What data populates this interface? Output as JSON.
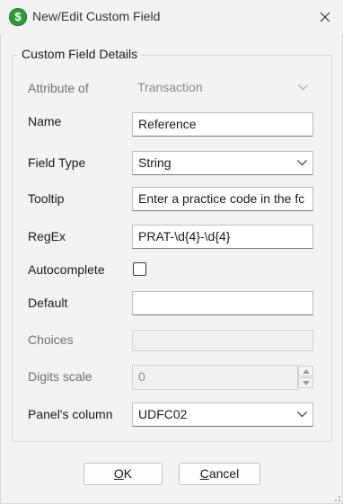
{
  "window": {
    "title": "New/Edit Custom Field",
    "app_icon_glyph": "$",
    "app_icon": "dollar-icon",
    "close_icon": "close-icon",
    "accent_color": "#2e9b3b"
  },
  "group": {
    "title": "Custom Field Details"
  },
  "form": {
    "attribute_of": {
      "label": "Attribute of",
      "value": "Transaction",
      "disabled": true
    },
    "name": {
      "label": "Name",
      "value": "Reference"
    },
    "field_type": {
      "label": "Field Type",
      "value": "String"
    },
    "tooltip": {
      "label": "Tooltip",
      "value": "Enter a practice code in the fc"
    },
    "regex": {
      "label": "RegEx",
      "value": "PRAT-\\d{4}-\\d{4}"
    },
    "autocomplete": {
      "label": "Autocomplete",
      "checked": false
    },
    "default": {
      "label": "Default",
      "value": ""
    },
    "choices": {
      "label": "Choices",
      "value": "",
      "disabled": true
    },
    "digits_scale": {
      "label": "Digits scale",
      "value": "0",
      "disabled": true
    },
    "panels_column": {
      "label": "Panel's column",
      "value": "UDFC02"
    }
  },
  "buttons": {
    "ok": {
      "mnemonic": "O",
      "rest": "K"
    },
    "cancel": {
      "mnemonic": "C",
      "rest": "ancel"
    }
  }
}
